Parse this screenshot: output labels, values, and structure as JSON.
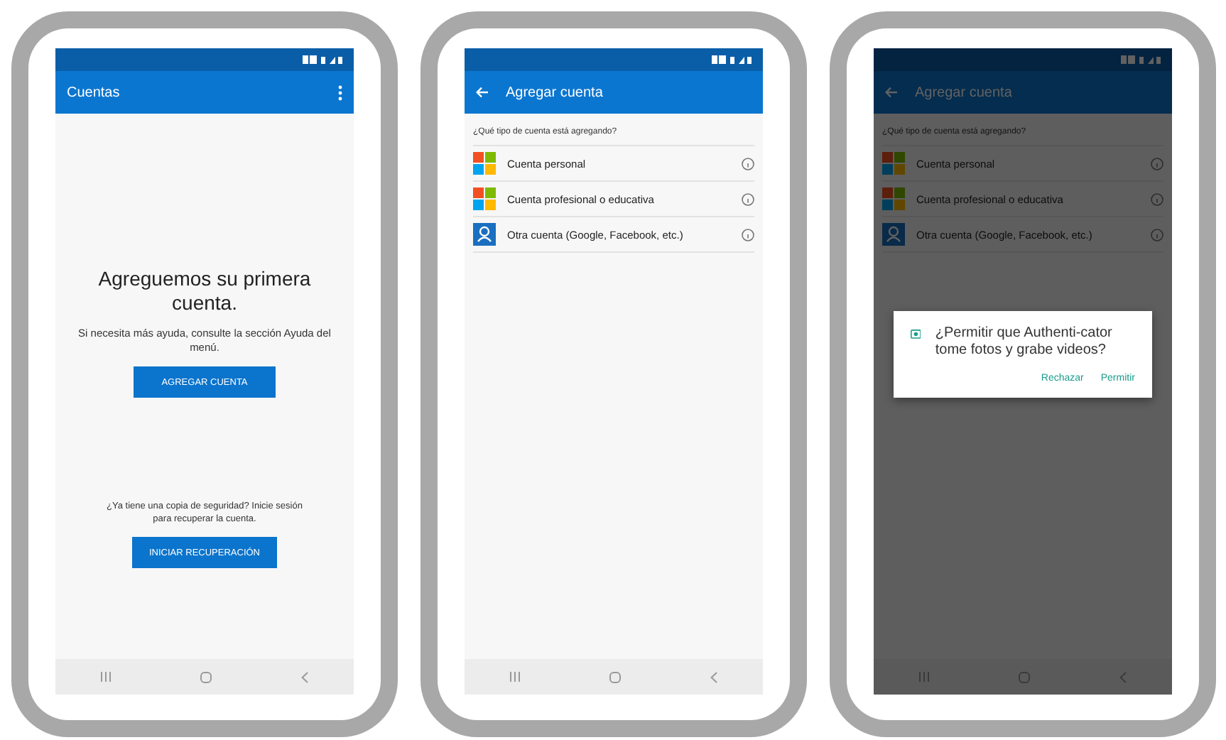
{
  "screens": [
    {
      "kind": "home",
      "title": "Cuentas",
      "heading": "Agreguemos su primera cuenta.",
      "help": "Si necesita más ayuda, consulte la sección Ayuda del menú.",
      "primary_button": "AGREGAR CUENTA",
      "backup_text": "¿Ya tiene una copia de seguridad? Inicie sesión para recuperar la cuenta.",
      "backup_button": "INICIAR RECUPERACIÓN"
    },
    {
      "kind": "add",
      "title": "Agregar cuenta",
      "prompt": "¿Qué tipo de cuenta está agregando?",
      "options": [
        {
          "label": "Cuenta personal",
          "kind": "microsoft"
        },
        {
          "label": "Cuenta profesional o educativa",
          "kind": "microsoft"
        },
        {
          "label": "Otra cuenta (Google, Facebook, etc.)",
          "kind": "other"
        }
      ]
    },
    {
      "kind": "add",
      "title": "Agregar cuenta",
      "prompt": "¿Qué tipo de cuenta está agregando?",
      "options": [
        {
          "label": "Cuenta personal",
          "kind": "microsoft"
        },
        {
          "label": "Cuenta profesional o educativa",
          "kind": "microsoft"
        },
        {
          "label": "Otra cuenta (Google, Facebook, etc.)",
          "kind": "other"
        }
      ],
      "dialog": {
        "message": "¿Permitir que Authenti-cator tome fotos y grabe videos?",
        "buttons": [
          "Rechazar",
          "Permitir"
        ]
      }
    }
  ]
}
